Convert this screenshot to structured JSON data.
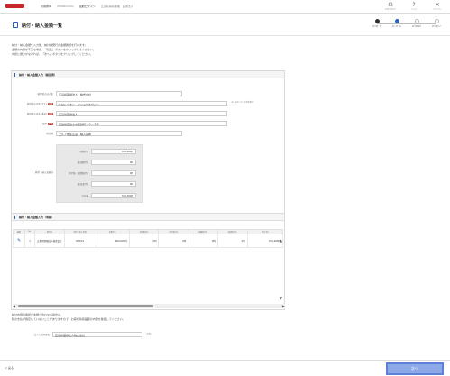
{
  "header": {
    "id_label": "利用者ID",
    "id_value": "(RNGK1234)",
    "name_label": "最終ログイン",
    "name_value": "広島県病院事業　医療法人",
    "icons": [
      {
        "name": "headset-icon",
        "glyph": "☊",
        "label": "お問い合わせ"
      },
      {
        "name": "help-icon",
        "glyph": "?",
        "label": "ヘルプ"
      },
      {
        "name": "close-icon",
        "glyph": "✕",
        "label": "ログアウト"
      }
    ]
  },
  "title": "納付・納入金額一覧",
  "steps": [
    {
      "label": "納付書一覧",
      "state": "done"
    },
    {
      "label": "納入金一覧",
      "state": "cur"
    },
    {
      "label": "納付書確認",
      "state": "todo"
    },
    {
      "label": "納付書完了",
      "state": "todo"
    }
  ],
  "intro": [
    "納付・納入金額を入力後、納付書発行の金額確認を行います。",
    "金額の内訳が不正な場合、「編集」ボタンをクリックしてください。",
    "内訳に誤りがなければ、「次へ」ボタンをクリックしてください。"
  ],
  "section1": {
    "title": "納付・納入金額入力（総括表）",
    "fields": [
      {
        "label": "納付者の法人名",
        "value": "広島県医療法人　株式会社",
        "required": false
      },
      {
        "label": "納付者の氏名(カナ)",
        "value": "ヒロシマケン　イリョウホウジン",
        "required": true,
        "note": "(法人名を入力、半角英数字)"
      },
      {
        "label": "納付者の氏名(漢字)",
        "value": "広島県医療法人",
        "required": true
      },
      {
        "label": "住所",
        "value": "広島県広島市中区基町１０－５２",
        "required": true
      },
      {
        "label": "所在地",
        "value": "エルア地区広島　納入事務",
        "required": false
      }
    ],
    "amount_label": "納付・納入金額計",
    "amounts": [
      {
        "label": "本税(円)",
        "value": "600,000円"
      },
      {
        "label": "延滞税(円)",
        "value": "0円"
      },
      {
        "label": "利子税・加算税(円)",
        "value": "0円"
      },
      {
        "label": "延滞金(円)",
        "value": "0円"
      },
      {
        "label": "合計額",
        "value": "600,000円"
      }
    ]
  },
  "section2": {
    "title": "納付・納入金額入力（明細）",
    "columns": [
      "編集",
      "No.",
      "納付者",
      "納付・納入年度",
      "本税(円)",
      "延滞税(円)",
      "利子税(円)",
      "加算税(円)",
      "延滞金(円)",
      "合計(円)"
    ],
    "rows": [
      {
        "no": "1",
        "name": "広島県医療法人株式会社",
        "year": "R05/12",
        "tax": "600,000円",
        "late": "0円",
        "interest": "0円",
        "add": "0円",
        "latefee": "0円",
        "total": "600,000円"
      }
    ]
  },
  "bottom_note": [
    "納付内容の確認が金額と合わない場合は、",
    "税の支払が確定していないことがありますので、お客様情報画面の内容を確認してください。"
  ],
  "bottom_field": {
    "label": "法人の納付者名",
    "value": "広島県医療法人株式会社",
    "hint": "(半角)"
  },
  "footer": {
    "back": "＜ 戻る",
    "next": "次へ"
  }
}
